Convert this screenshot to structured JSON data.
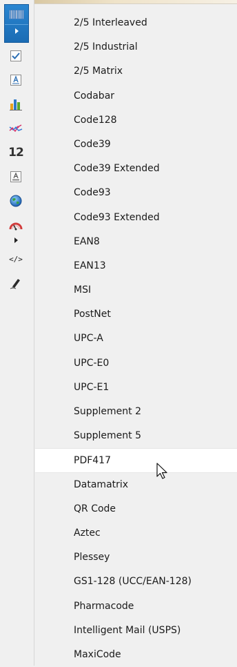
{
  "toolbar": {
    "tools": [
      {
        "name": "barcode-tool",
        "icon": "barcode-icon",
        "selected": true
      },
      {
        "name": "checkbox-tool",
        "icon": "checkbox-icon"
      },
      {
        "name": "label-tool",
        "icon": "label-a-icon"
      },
      {
        "name": "chart-tool",
        "icon": "bar-chart-icon"
      },
      {
        "name": "sparkline-tool",
        "icon": "sparkline-icon"
      },
      {
        "name": "page-number-tool",
        "icon": "page-number-icon",
        "glyph": "12"
      },
      {
        "name": "richtext-tool",
        "icon": "richtext-icon"
      },
      {
        "name": "map-tool",
        "icon": "globe-icon"
      },
      {
        "name": "gauge-tool",
        "icon": "gauge-icon"
      },
      {
        "name": "more-tools",
        "icon": "arrow-right-icon"
      },
      {
        "name": "html-tool",
        "icon": "code-icon",
        "glyph": "</>"
      },
      {
        "name": "signature-tool",
        "icon": "pen-icon"
      }
    ]
  },
  "menu": {
    "items": [
      "2/5 Interleaved",
      "2/5 Industrial",
      "2/5 Matrix",
      "Codabar",
      "Code128",
      "Code39",
      "Code39 Extended",
      "Code93",
      "Code93 Extended",
      "EAN8",
      "EAN13",
      "MSI",
      "PostNet",
      "UPC-A",
      "UPC-E0",
      "UPC-E1",
      "Supplement 2",
      "Supplement 5",
      "PDF417",
      "Datamatrix",
      "QR Code",
      "Aztec",
      "Plessey",
      "GS1-128 (UCC/EAN-128)",
      "Pharmacode",
      "Intelligent Mail (USPS)",
      "MaxiCode"
    ],
    "hovered_index": 18
  },
  "colors": {
    "selection": "#1f74bd",
    "hover": "#ffffff",
    "background": "#f0f0f0"
  }
}
